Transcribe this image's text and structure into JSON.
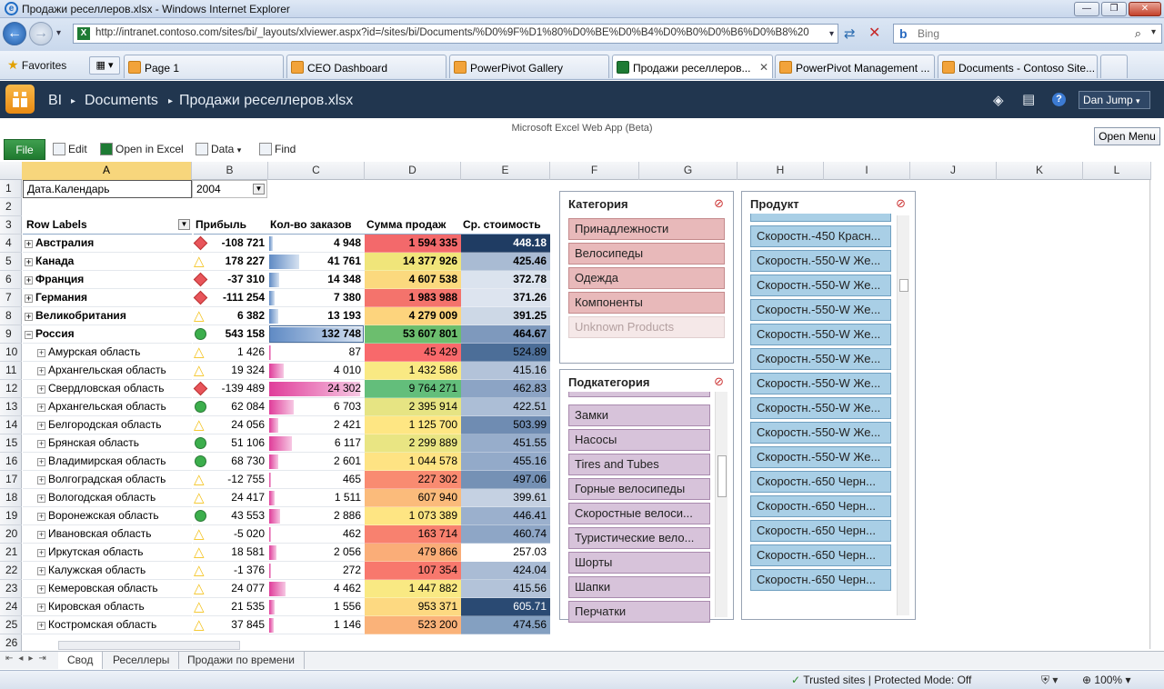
{
  "window": {
    "title": "Продажи реселлеров.xlsx - Windows Internet Explorer"
  },
  "address": {
    "url": "http://intranet.contoso.com/sites/bi/_layouts/xlviewer.aspx?id=/sites/bi/Documents/%D0%9F%D1%80%D0%BE%D0%B4%D0%B0%D0%B6%D0%B8%20",
    "search_placeholder": "Bing"
  },
  "favorites": {
    "label": "Favorites"
  },
  "tabs": [
    {
      "label": "Page 1"
    },
    {
      "label": "CEO Dashboard"
    },
    {
      "label": "PowerPivot Gallery"
    },
    {
      "label": "Продажи реселлеров..."
    },
    {
      "label": "PowerPivot Management ..."
    },
    {
      "label": "Documents - Contoso Site..."
    }
  ],
  "sharepoint": {
    "site": "BI",
    "library": "Documents",
    "file": "Продажи реселлеров.xlsx",
    "user": "Dan Jump"
  },
  "ewa": {
    "caption": "Microsoft Excel Web App (Beta)",
    "file": "File",
    "edit": "Edit",
    "open_excel": "Open in Excel",
    "data": "Data",
    "find": "Find",
    "open_menu": "Open Menu"
  },
  "columns": [
    "A",
    "B",
    "C",
    "D",
    "E",
    "F",
    "G",
    "H",
    "I",
    "J",
    "K",
    "L"
  ],
  "rownums": [
    "1",
    "2",
    "3",
    "4",
    "5",
    "6",
    "7",
    "8",
    "9",
    "10",
    "11",
    "12",
    "13",
    "14",
    "15",
    "16",
    "17",
    "18",
    "19",
    "20",
    "21",
    "22",
    "23",
    "24",
    "25",
    "26"
  ],
  "filter": {
    "label": "Дата.Календарь",
    "value": "2004"
  },
  "headers": {
    "labels": "Row Labels",
    "profit": "Прибыль",
    "orders": "Кол-во заказов",
    "sales": "Сумма продаж",
    "cost": "Ср. стоимость"
  },
  "rows": [
    {
      "label": "Австралия",
      "level": 0,
      "icon": "diamond",
      "profit": "-108 721",
      "orders": "4 948",
      "ofrac": 0.04,
      "sales": "1 594 335",
      "scolor": "#f3696b",
      "cost": "448.18",
      "ccolor": "#1f3c63",
      "ctext": "#ffffff"
    },
    {
      "label": "Канада",
      "level": 0,
      "icon": "triangle",
      "profit": "178 227",
      "orders": "41 761",
      "ofrac": 0.32,
      "sales": "14 377 926",
      "scolor": "#f0e57a",
      "cost": "425.46",
      "ccolor": "#a9bbd3",
      "ctext": "#000000"
    },
    {
      "label": "Франция",
      "level": 0,
      "icon": "diamond",
      "profit": "-37 310",
      "orders": "14 348",
      "ofrac": 0.11,
      "sales": "4 607 538",
      "scolor": "#fbd97e",
      "cost": "372.78",
      "ccolor": "#dbe3ee",
      "ctext": "#000000"
    },
    {
      "label": "Германия",
      "level": 0,
      "icon": "diamond",
      "profit": "-111 254",
      "orders": "7 380",
      "ofrac": 0.06,
      "sales": "1 983 988",
      "scolor": "#f4736c",
      "cost": "371.26",
      "ccolor": "#dde4ef",
      "ctext": "#000000"
    },
    {
      "label": "Великобритания",
      "level": 0,
      "icon": "triangle",
      "profit": "6 382",
      "orders": "13 193",
      "ofrac": 0.1,
      "sales": "4 279 009",
      "scolor": "#fdd47d",
      "cost": "391.25",
      "ccolor": "#cdd8e6",
      "ctext": "#000000"
    },
    {
      "label": "Россия",
      "level": 0,
      "icon": "circle",
      "profit": "543 158",
      "orders": "132 748",
      "ofrac": 1.0,
      "sales": "53 607 801",
      "scolor": "#6cbe6e",
      "cost": "464.67",
      "ccolor": "#7e99bd",
      "ctext": "#000000"
    },
    {
      "label": "Амурская область",
      "level": 1,
      "icon": "triangle",
      "profit": "1 426",
      "orders": "87",
      "ofrac": 0.0,
      "sales": "45 429",
      "scolor": "#f8696b",
      "cost": "524.89",
      "ccolor": "#4c6e98",
      "ctext": "#000000"
    },
    {
      "label": "Архангельская область",
      "level": 1,
      "icon": "triangle",
      "profit": "19 324",
      "orders": "4 010",
      "ofrac": 0.16,
      "sales": "1 432 586",
      "scolor": "#f9e983",
      "cost": "415.16",
      "ccolor": "#b3c3d9",
      "ctext": "#000000"
    },
    {
      "label": "Свердловская область",
      "level": 1,
      "icon": "diamond",
      "profit": "-139 489",
      "orders": "24 302",
      "ofrac": 1.0,
      "sales": "9 764 271",
      "scolor": "#63be7b",
      "cost": "462.83",
      "ccolor": "#8ca4c5",
      "ctext": "#000000"
    },
    {
      "label": "Архангельская область",
      "level": 1,
      "icon": "circle",
      "profit": "62 084",
      "orders": "6 703",
      "ofrac": 0.27,
      "sales": "2 395 914",
      "scolor": "#e6e483",
      "cost": "422.51",
      "ccolor": "#acbed6",
      "ctext": "#000000"
    },
    {
      "label": "Белгородская область",
      "level": 1,
      "icon": "triangle",
      "profit": "24 056",
      "orders": "2 421",
      "ofrac": 0.1,
      "sales": "1 125 700",
      "scolor": "#fee683",
      "cost": "503.99",
      "ccolor": "#6f8cb2",
      "ctext": "#000000"
    },
    {
      "label": "Брянская область",
      "level": 1,
      "icon": "circle",
      "profit": "51 106",
      "orders": "6 117",
      "ofrac": 0.25,
      "sales": "2 299 889",
      "scolor": "#e9e583",
      "cost": "451.55",
      "ccolor": "#97adcb",
      "ctext": "#000000"
    },
    {
      "label": "Владимирская область",
      "level": 1,
      "icon": "circle",
      "profit": "68 730",
      "orders": "2 601",
      "ofrac": 0.1,
      "sales": "1 044 578",
      "scolor": "#fee383",
      "cost": "455.16",
      "ccolor": "#93aac9",
      "ctext": "#000000"
    },
    {
      "label": "Волгоградская область",
      "level": 1,
      "icon": "triangle",
      "profit": "-12 755",
      "orders": "465",
      "ofrac": 0.02,
      "sales": "227 302",
      "scolor": "#f98b71",
      "cost": "497.06",
      "ccolor": "#7591b5",
      "ctext": "#000000"
    },
    {
      "label": "Вологодская область",
      "level": 1,
      "icon": "triangle",
      "profit": "24 417",
      "orders": "1 511",
      "ofrac": 0.06,
      "sales": "607 940",
      "scolor": "#fbbb7b",
      "cost": "399.61",
      "ccolor": "#c5d1e2",
      "ctext": "#000000"
    },
    {
      "label": "Воронежская область",
      "level": 1,
      "icon": "circle",
      "profit": "43 553",
      "orders": "2 886",
      "ofrac": 0.12,
      "sales": "1 073 389",
      "scolor": "#fee583",
      "cost": "446.41",
      "ccolor": "#9bb0cd",
      "ctext": "#000000"
    },
    {
      "label": "Ивановская область",
      "level": 1,
      "icon": "triangle",
      "profit": "-5 020",
      "orders": "462",
      "ofrac": 0.02,
      "sales": "163 714",
      "scolor": "#f8816f",
      "cost": "460.74",
      "ccolor": "#8ea6c6",
      "ctext": "#000000"
    },
    {
      "label": "Иркутская область",
      "level": 1,
      "icon": "triangle",
      "profit": "18 581",
      "orders": "2 056",
      "ofrac": 0.08,
      "sales": "479 866",
      "scolor": "#faad78",
      "cost": "257.03",
      "ccolor": "#ffffff",
      "ctext": "#000000"
    },
    {
      "label": "Калужская область",
      "level": 1,
      "icon": "triangle",
      "profit": "-1 376",
      "orders": "272",
      "ofrac": 0.01,
      "sales": "107 354",
      "scolor": "#f8786d",
      "cost": "424.04",
      "ccolor": "#aabcd5",
      "ctext": "#000000"
    },
    {
      "label": "Кемеровская область",
      "level": 1,
      "icon": "triangle",
      "profit": "24 077",
      "orders": "4 462",
      "ofrac": 0.18,
      "sales": "1 447 882",
      "scolor": "#f9e983",
      "cost": "415.56",
      "ccolor": "#b3c3d9",
      "ctext": "#000000"
    },
    {
      "label": "Кировская область",
      "level": 1,
      "icon": "triangle",
      "profit": "21 535",
      "orders": "1 556",
      "ofrac": 0.06,
      "sales": "953 371",
      "scolor": "#fdd981",
      "cost": "605.71",
      "ccolor": "#2a4a73",
      "ctext": "#ffffff"
    },
    {
      "label": "Костромская область",
      "level": 1,
      "icon": "triangle",
      "profit": "37 845",
      "orders": "1 146",
      "ofrac": 0.05,
      "sales": "523 200",
      "scolor": "#fab279",
      "cost": "474.56",
      "ccolor": "#84a0c1",
      "ctext": "#000000"
    }
  ],
  "slicer_category": {
    "title": "Категория",
    "items": [
      "Принадлежности",
      "Велосипеды",
      "Одежда",
      "Компоненты",
      "Unknown Products"
    ]
  },
  "slicer_subcategory": {
    "title": "Подкатегория",
    "items": [
      "Замки",
      "Насосы",
      "Tires and Tubes",
      "Горные велосипеды",
      "Скоростные велоси...",
      "Туристические вело...",
      "Шорты",
      "Шапки",
      "Перчатки"
    ]
  },
  "slicer_product": {
    "title": "Продукт",
    "items": [
      "Скоростн.-450 Красн...",
      "Скоростн.-550-W Же...",
      "Скоростн.-550-W Же...",
      "Скоростн.-550-W Же...",
      "Скоростн.-550-W Же...",
      "Скоростн.-550-W Же...",
      "Скоростн.-550-W Же...",
      "Скоростн.-550-W Же...",
      "Скоростн.-550-W Же...",
      "Скоростн.-550-W Же...",
      "Скоростн.-650 Черн...",
      "Скоростн.-650 Черн...",
      "Скоростн.-650 Черн...",
      "Скоростн.-650 Черн...",
      "Скоростн.-650 Черн..."
    ]
  },
  "sheets": [
    "Свод",
    "Реселлеры",
    "Продажи по времени"
  ],
  "status": {
    "zone": "Trusted sites | Protected Mode: Off",
    "zoom": "100%"
  }
}
